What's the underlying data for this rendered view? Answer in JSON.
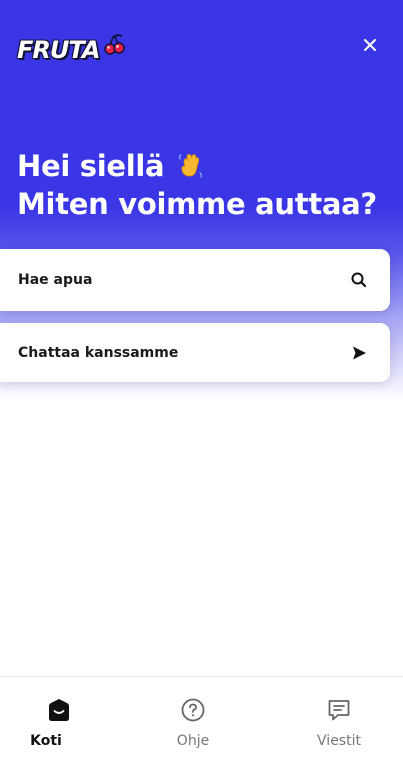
{
  "header": {
    "logo_text": "FRUTA",
    "close_label": "×"
  },
  "hero": {
    "greeting_line1": "Hei siellä",
    "greeting_line2": "Miten voimme auttaa?"
  },
  "cards": {
    "search_label": "Hae apua",
    "chat_label": "Chattaa kanssamme"
  },
  "bottom_nav": {
    "items": [
      {
        "label": "Koti",
        "icon": "home-icon",
        "active": true
      },
      {
        "label": "Ohje",
        "icon": "help-icon",
        "active": false
      },
      {
        "label": "Viestit",
        "icon": "messages-icon",
        "active": false
      }
    ]
  },
  "colors": {
    "brand_primary": "#3a36e6",
    "text_dark": "#1a1a1a",
    "nav_inactive": "#777777"
  }
}
